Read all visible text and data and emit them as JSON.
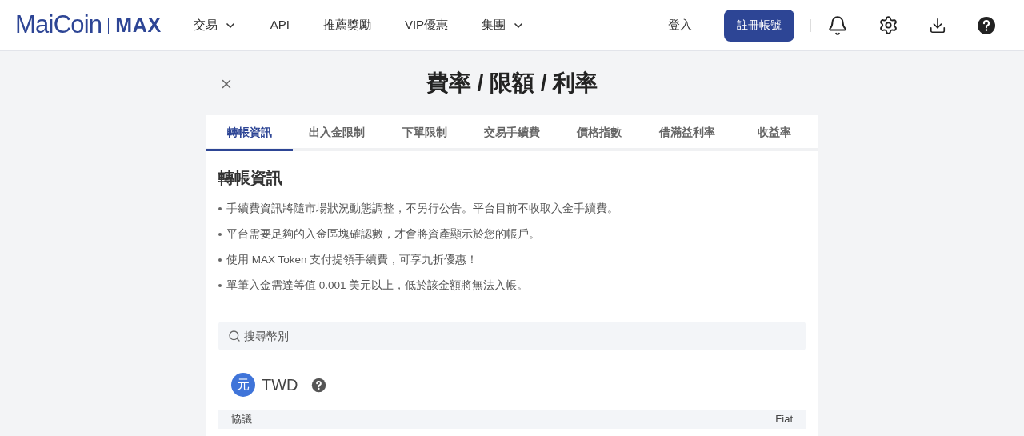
{
  "header": {
    "logo": {
      "brand": "MaiCoin",
      "product": "MAX"
    },
    "nav": [
      {
        "label": "交易",
        "dropdown": true
      },
      {
        "label": "API",
        "dropdown": false
      },
      {
        "label": "推薦獎勵",
        "dropdown": false
      },
      {
        "label": "VIP優惠",
        "dropdown": false
      },
      {
        "label": "集團",
        "dropdown": true
      }
    ],
    "login": "登入",
    "signup": "註冊帳號"
  },
  "page": {
    "title": "費率 / 限額 / 利率"
  },
  "tabs": [
    {
      "label": "轉帳資訊",
      "selected": true
    },
    {
      "label": "出入金限制",
      "selected": false
    },
    {
      "label": "下單限制",
      "selected": false
    },
    {
      "label": "交易手續費",
      "selected": false
    },
    {
      "label": "價格指數",
      "selected": false
    },
    {
      "label": "借滿益利率",
      "selected": false
    },
    {
      "label": "收益率",
      "selected": false
    }
  ],
  "section": {
    "heading": "轉帳資訊",
    "notes": [
      "手續費資訊將隨市場狀況動態調整，不另行公告。平台目前不收取入金手續費。",
      "平台需要足夠的入金區塊確認數，才會將資產顯示於您的帳戶。",
      "使用 MAX Token 支付提領手續費，可享九折優惠！",
      "單筆入金需達等值 0.001 美元以上，低於該金額將無法入帳。"
    ]
  },
  "search": {
    "placeholder": "搜尋幣別"
  },
  "currency": {
    "symbol": "元",
    "code": "TWD",
    "table": {
      "columns": [
        "協議",
        "Fiat"
      ]
    }
  }
}
